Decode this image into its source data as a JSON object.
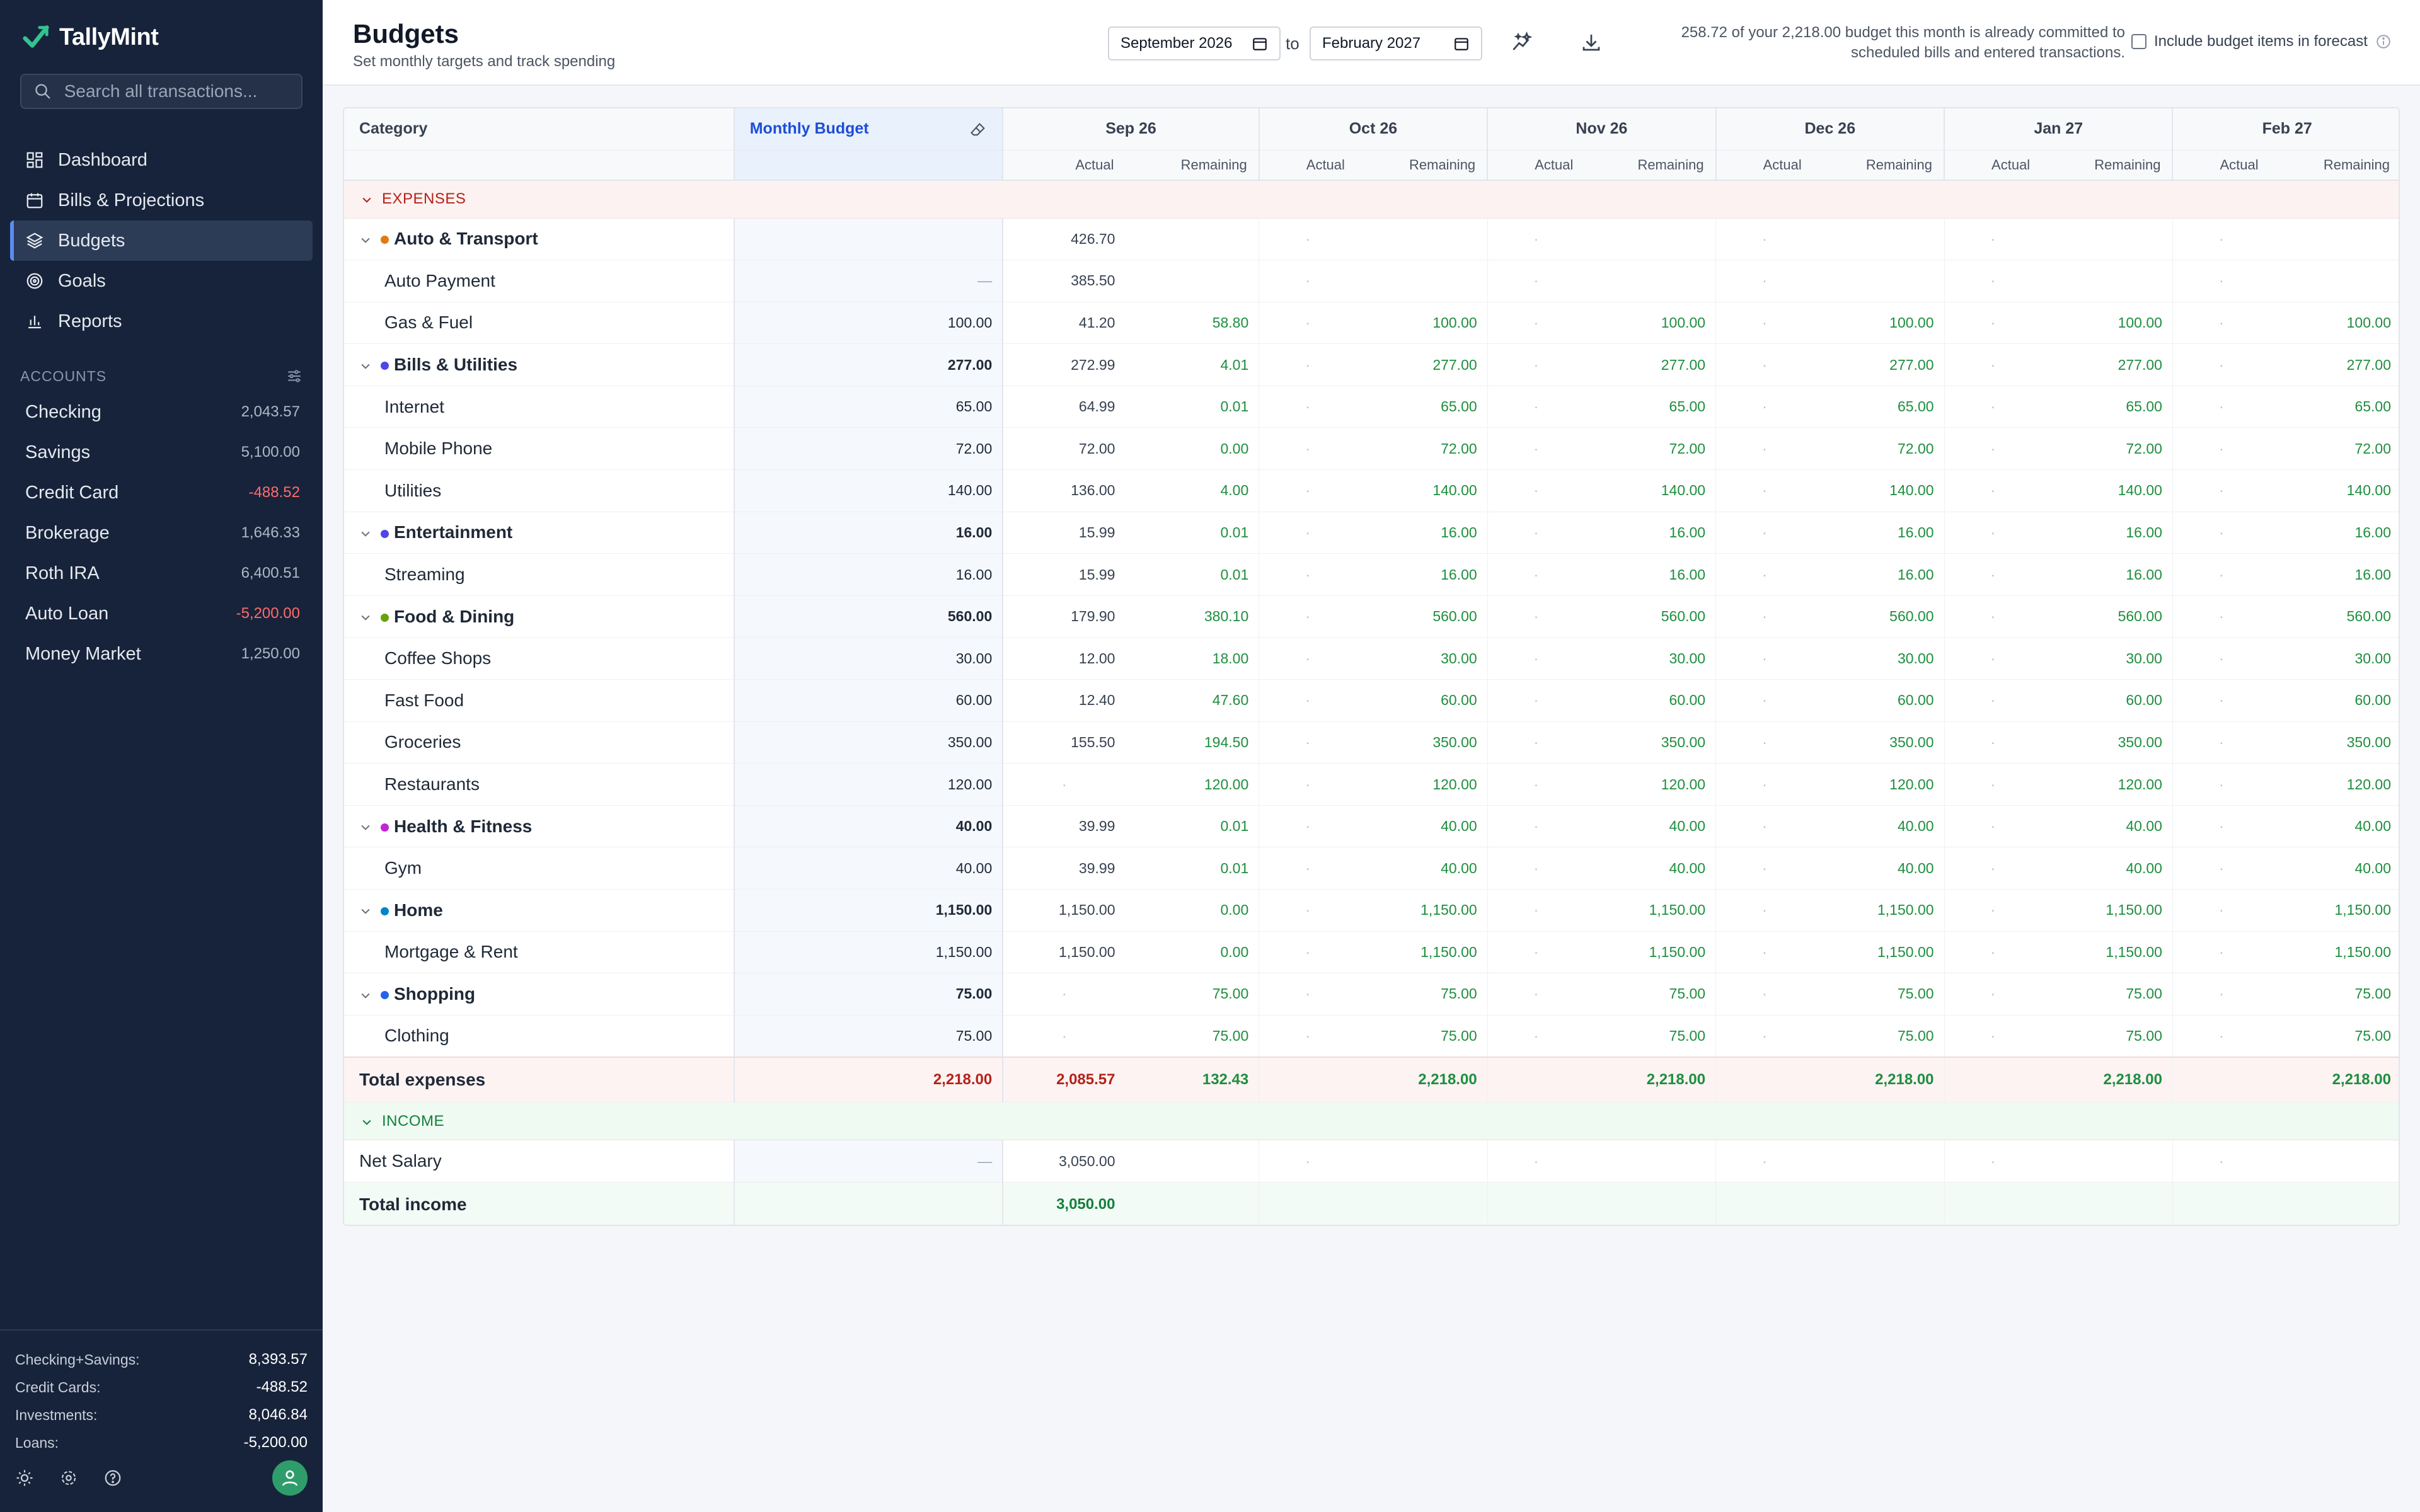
{
  "app": {
    "name": "TallyMint",
    "search_placeholder": "Search all transactions...",
    "nav": [
      {
        "label": "Dashboard",
        "icon": "dashboard-icon"
      },
      {
        "label": "Bills & Projections",
        "icon": "calendar-icon"
      },
      {
        "label": "Budgets",
        "icon": "layers-icon"
      },
      {
        "label": "Goals",
        "icon": "target-icon"
      },
      {
        "label": "Reports",
        "icon": "bar-chart-icon"
      }
    ],
    "accounts_heading": "ACCOUNTS",
    "accounts": [
      {
        "name": "Checking",
        "balance": "2,043.57"
      },
      {
        "name": "Savings",
        "balance": "5,100.00"
      },
      {
        "name": "Credit Card",
        "balance": "-488.52"
      },
      {
        "name": "Brokerage",
        "balance": "1,646.33"
      },
      {
        "name": "Roth IRA",
        "balance": "6,400.51"
      },
      {
        "name": "Auto Loan",
        "balance": "-5,200.00"
      },
      {
        "name": "Money Market",
        "balance": "1,250.00"
      }
    ],
    "summary": [
      {
        "label": "Checking+Savings:",
        "value": "8,393.57"
      },
      {
        "label": "Credit Cards:",
        "value": "-488.52"
      },
      {
        "label": "Investments:",
        "value": "8,046.84"
      },
      {
        "label": "Loans:",
        "value": "-5,200.00"
      }
    ]
  },
  "header": {
    "title": "Budgets",
    "subtitle": "Set monthly targets and track spending",
    "date_from": "September 2026",
    "to_label": "to",
    "date_to": "February 2027",
    "info_line1": "258.72 of your 2,218.00 budget this month is already committed to",
    "info_line2": "scheduled bills and entered transactions.",
    "forecast_label": "Include budget items in forecast"
  },
  "table": {
    "col_category": "Category",
    "col_budget": "Monthly Budget",
    "months": [
      "Sep 26",
      "Oct 26",
      "Nov 26",
      "Dec 26",
      "Jan 27",
      "Feb 27"
    ],
    "sub_actual": "Actual",
    "sub_remaining": "Remaining",
    "expenses_label": "EXPENSES",
    "income_label": "INCOME",
    "rows": [
      {
        "t": "g",
        "name": "Auto & Transport",
        "color": "#e07b12",
        "budget": "",
        "cells": [
          "426.70",
          "",
          "·",
          "",
          "·",
          "",
          "·",
          "",
          "·",
          "",
          "·",
          ""
        ]
      },
      {
        "t": "s",
        "name": "Auto Payment",
        "budget": "—",
        "cells": [
          "385.50",
          "",
          "·",
          "",
          "·",
          "",
          "·",
          "",
          "·",
          "",
          "·",
          ""
        ]
      },
      {
        "t": "s",
        "name": "Gas & Fuel",
        "budget": "100.00",
        "cells": [
          "41.20",
          "58.80",
          "·",
          "100.00",
          "·",
          "100.00",
          "·",
          "100.00",
          "·",
          "100.00",
          "·",
          "100.00"
        ]
      },
      {
        "t": "g",
        "name": "Bills & Utilities",
        "color": "#4f46e5",
        "budget": "277.00",
        "cells": [
          "272.99",
          "4.01",
          "·",
          "277.00",
          "·",
          "277.00",
          "·",
          "277.00",
          "·",
          "277.00",
          "·",
          "277.00"
        ]
      },
      {
        "t": "s",
        "name": "Internet",
        "budget": "65.00",
        "cells": [
          "64.99",
          "0.01",
          "·",
          "65.00",
          "·",
          "65.00",
          "·",
          "65.00",
          "·",
          "65.00",
          "·",
          "65.00"
        ]
      },
      {
        "t": "s",
        "name": "Mobile Phone",
        "budget": "72.00",
        "cells": [
          "72.00",
          "0.00",
          "·",
          "72.00",
          "·",
          "72.00",
          "·",
          "72.00",
          "·",
          "72.00",
          "·",
          "72.00"
        ]
      },
      {
        "t": "s",
        "name": "Utilities",
        "budget": "140.00",
        "cells": [
          "136.00",
          "4.00",
          "·",
          "140.00",
          "·",
          "140.00",
          "·",
          "140.00",
          "·",
          "140.00",
          "·",
          "140.00"
        ]
      },
      {
        "t": "g",
        "name": "Entertainment",
        "color": "#4f46e5",
        "budget": "16.00",
        "cells": [
          "15.99",
          "0.01",
          "·",
          "16.00",
          "·",
          "16.00",
          "·",
          "16.00",
          "·",
          "16.00",
          "·",
          "16.00"
        ]
      },
      {
        "t": "s",
        "name": "Streaming",
        "budget": "16.00",
        "cells": [
          "15.99",
          "0.01",
          "·",
          "16.00",
          "·",
          "16.00",
          "·",
          "16.00",
          "·",
          "16.00",
          "·",
          "16.00"
        ]
      },
      {
        "t": "g",
        "name": "Food & Dining",
        "color": "#65a30d",
        "budget": "560.00",
        "cells": [
          "179.90",
          "380.10",
          "·",
          "560.00",
          "·",
          "560.00",
          "·",
          "560.00",
          "·",
          "560.00",
          "·",
          "560.00"
        ]
      },
      {
        "t": "s",
        "name": "Coffee Shops",
        "budget": "30.00",
        "cells": [
          "12.00",
          "18.00",
          "·",
          "30.00",
          "·",
          "30.00",
          "·",
          "30.00",
          "·",
          "30.00",
          "·",
          "30.00"
        ]
      },
      {
        "t": "s",
        "name": "Fast Food",
        "budget": "60.00",
        "cells": [
          "12.40",
          "47.60",
          "·",
          "60.00",
          "·",
          "60.00",
          "·",
          "60.00",
          "·",
          "60.00",
          "·",
          "60.00"
        ]
      },
      {
        "t": "s",
        "name": "Groceries",
        "budget": "350.00",
        "cells": [
          "155.50",
          "194.50",
          "·",
          "350.00",
          "·",
          "350.00",
          "·",
          "350.00",
          "·",
          "350.00",
          "·",
          "350.00"
        ]
      },
      {
        "t": "s",
        "name": "Restaurants",
        "budget": "120.00",
        "cells": [
          "·",
          "120.00",
          "·",
          "120.00",
          "·",
          "120.00",
          "·",
          "120.00",
          "·",
          "120.00",
          "·",
          "120.00"
        ]
      },
      {
        "t": "g",
        "name": "Health & Fitness",
        "color": "#c026d3",
        "budget": "40.00",
        "cells": [
          "39.99",
          "0.01",
          "·",
          "40.00",
          "·",
          "40.00",
          "·",
          "40.00",
          "·",
          "40.00",
          "·",
          "40.00"
        ]
      },
      {
        "t": "s",
        "name": "Gym",
        "budget": "40.00",
        "cells": [
          "39.99",
          "0.01",
          "·",
          "40.00",
          "·",
          "40.00",
          "·",
          "40.00",
          "·",
          "40.00",
          "·",
          "40.00"
        ]
      },
      {
        "t": "g",
        "name": "Home",
        "color": "#0284c7",
        "budget": "1,150.00",
        "cells": [
          "1,150.00",
          "0.00",
          "·",
          "1,150.00",
          "·",
          "1,150.00",
          "·",
          "1,150.00",
          "·",
          "1,150.00",
          "·",
          "1,150.00"
        ]
      },
      {
        "t": "s",
        "name": "Mortgage & Rent",
        "budget": "1,150.00",
        "cells": [
          "1,150.00",
          "0.00",
          "·",
          "1,150.00",
          "·",
          "1,150.00",
          "·",
          "1,150.00",
          "·",
          "1,150.00",
          "·",
          "1,150.00"
        ]
      },
      {
        "t": "g",
        "name": "Shopping",
        "color": "#2563eb",
        "budget": "75.00",
        "cells": [
          "·",
          "75.00",
          "·",
          "75.00",
          "·",
          "75.00",
          "·",
          "75.00",
          "·",
          "75.00",
          "·",
          "75.00"
        ]
      },
      {
        "t": "s",
        "name": "Clothing",
        "budget": "75.00",
        "cells": [
          "·",
          "75.00",
          "·",
          "75.00",
          "·",
          "75.00",
          "·",
          "75.00",
          "·",
          "75.00",
          "·",
          "75.00"
        ]
      }
    ],
    "total_expenses": {
      "label": "Total expenses",
      "budget": "2,218.00",
      "cells": [
        "2,085.57",
        "132.43",
        "",
        "2,218.00",
        "",
        "2,218.00",
        "",
        "2,218.00",
        "",
        "2,218.00",
        "",
        "2,218.00"
      ]
    },
    "income_rows": [
      {
        "name": "Net Salary",
        "budget": "—",
        "cells": [
          "3,050.00",
          "",
          "·",
          "",
          "·",
          "",
          "·",
          "",
          "·",
          "",
          "·",
          ""
        ]
      }
    ],
    "total_income": {
      "label": "Total income",
      "budget": "",
      "cells": [
        "3,050.00",
        "",
        "",
        "",
        "",
        "",
        "",
        "",
        "",
        "",
        "",
        ""
      ]
    }
  }
}
